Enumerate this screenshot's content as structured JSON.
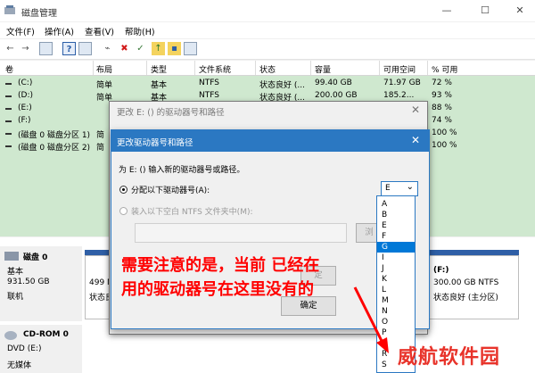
{
  "window": {
    "title": "磁盘管理"
  },
  "window_buttons": {
    "minimize": "—",
    "maximize": "☐",
    "close": "✕"
  },
  "menu": [
    "文件(F)",
    "操作(A)",
    "查看(V)",
    "帮助(H)"
  ],
  "table": {
    "headers": [
      "卷",
      "布局",
      "类型",
      "文件系统",
      "状态",
      "容量",
      "可用空间",
      "% 可用"
    ],
    "rows": [
      [
        "(C:)",
        "简单",
        "基本",
        "NTFS",
        "状态良好 (...",
        "99.40 GB",
        "71.97 GB",
        "72 %"
      ],
      [
        "(D:)",
        "简单",
        "基本",
        "NTFS",
        "状态良好 (...",
        "200.00 GB",
        "185.2...",
        "93 %"
      ],
      [
        "(E:)",
        "",
        "",
        "",
        "",
        "",
        "",
        "88 %"
      ],
      [
        "(F:)",
        "",
        "",
        "",
        "",
        "",
        "",
        "74 %"
      ],
      [
        "(磁盘 0 磁盘分区 1)",
        "简",
        "",
        "",
        "",
        "",
        "",
        "100 %"
      ],
      [
        "(磁盘 0 磁盘分区 2)",
        "简",
        "",
        "",
        "",
        "",
        "",
        "100 %"
      ]
    ]
  },
  "lower": {
    "disk0": {
      "name": "磁盘 0",
      "type": "基本",
      "size": "931.50 GB",
      "status": "联机"
    },
    "partition_left": {
      "size": "499 M",
      "status": "状态良"
    },
    "partition_f": {
      "name": "(F:)",
      "size": "300.00 GB NTFS",
      "status": "状态良好 (主分区)"
    },
    "cdrom": {
      "name": "CD-ROM 0",
      "type": "DVD (E:)",
      "media": "无媒体"
    }
  },
  "dialog_back": {
    "title": "更改 E: () 的驱动器号和路径",
    "ok_label": "确定"
  },
  "dialog": {
    "title": "更改驱动器号和路径",
    "prompt": "为 E: () 输入新的驱动器号或路径。",
    "option_assign": "分配以下驱动器号(A):",
    "option_mount": "装入以下空白 NTFS 文件夹中(M):",
    "browse_label": "浏",
    "ok_label": "确定",
    "cancel_label": "定",
    "selected_letter": "E"
  },
  "dropdown": {
    "options": [
      "A",
      "B",
      "E",
      "F",
      "G",
      "I",
      "J",
      "K",
      "L",
      "M",
      "N",
      "O",
      "P",
      "Q",
      "R",
      "S"
    ],
    "highlighted": "G"
  },
  "annotation": "需要注意的是，当前 已经在用的驱动器号在这里没有的",
  "watermark": "威航软件园",
  "colors": {
    "accent": "#2b78c2",
    "volume_bg": "#cfe8cf",
    "annotation": "#ff0000",
    "selection": "#0078d7"
  }
}
